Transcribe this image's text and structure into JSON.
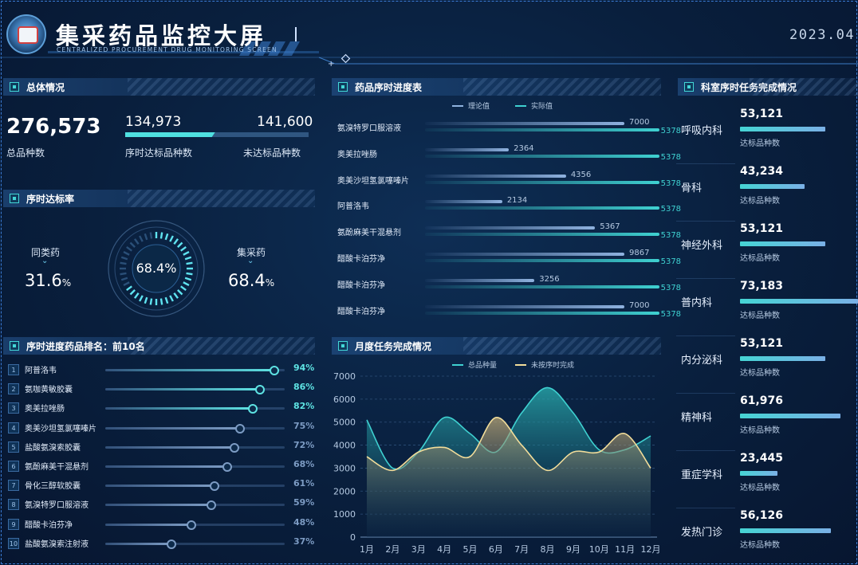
{
  "header": {
    "title": "集采药品监控大屏",
    "subtitle": "CENTRALIZED PROCUREMENT DRUG MONITORING SCREEN",
    "datetime": "2023.04."
  },
  "overview": {
    "title": "总体情况",
    "total_value": "276,573",
    "total_label": "总品种数",
    "on_time_value": "134,973",
    "on_time_label": "序时达标品种数",
    "not_met_value": "141,600",
    "not_met_label": "未达标品种数",
    "on_time_ratio": 0.49
  },
  "rate": {
    "title": "序时达标率",
    "similar_label": "同类药",
    "similar_value": "31.6",
    "center_value": "68.4%",
    "center_fraction": 0.684,
    "collected_label": "集采药",
    "collected_value": "68.4",
    "unit": "%"
  },
  "ranking": {
    "title": "序时进度药品排名：前10名",
    "items": [
      {
        "idx": "1",
        "name": "阿普洛韦",
        "pct": "94%",
        "value": 94
      },
      {
        "idx": "2",
        "name": "氨咖黄敏胶囊",
        "pct": "86%",
        "value": 86
      },
      {
        "idx": "3",
        "name": "奥美拉唑肠",
        "pct": "82%",
        "value": 82
      },
      {
        "idx": "4",
        "name": "奥美沙坦氢氯噻嗪片",
        "pct": "75%",
        "value": 75
      },
      {
        "idx": "5",
        "name": "盐酸氨溴索胶囊",
        "pct": "72%",
        "value": 72
      },
      {
        "idx": "6",
        "name": "氨酚麻美干混悬剂",
        "pct": "68%",
        "value": 68
      },
      {
        "idx": "7",
        "name": "骨化三醇软胶囊",
        "pct": "61%",
        "value": 61
      },
      {
        "idx": "8",
        "name": "氨溴特罗口服溶液",
        "pct": "59%",
        "value": 59
      },
      {
        "idx": "9",
        "name": "醋酸卡泊芬净",
        "pct": "48%",
        "value": 48
      },
      {
        "idx": "10",
        "name": "盐酸氨溴索注射液",
        "pct": "37%",
        "value": 37
      }
    ],
    "colors": {
      "top": "#5ee3e3",
      "rest": "#7d9cc4"
    }
  },
  "schedule": {
    "title": "药品序时进度表",
    "legend_theory": "理论值",
    "legend_actual": "实际值",
    "colors": {
      "theory": "#8fb2df",
      "actual": "#3fd1d1"
    },
    "items": [
      {
        "name": "氨溴特罗口服溶液",
        "theory": 7000,
        "actual": 5378,
        "theory_label": "7000",
        "actual_label": "5378"
      },
      {
        "name": "奥美拉唑肠",
        "theory": 2364,
        "actual": 5378,
        "theory_label": "2364",
        "actual_label": "5378"
      },
      {
        "name": "奥美沙坦氢氯噻嗪片",
        "theory": 4356,
        "actual": 5378,
        "theory_label": "4356",
        "actual_label": "5378"
      },
      {
        "name": "阿普洛韦",
        "theory": 2134,
        "actual": 5378,
        "theory_label": "2134",
        "actual_label": "5378"
      },
      {
        "name": "氨酚麻美干混悬剂",
        "theory": 5367,
        "actual": 5378,
        "theory_label": "5367",
        "actual_label": "5378"
      },
      {
        "name": "醋酸卡泊芬净",
        "theory": 9867,
        "actual": 5378,
        "theory_label": "9867",
        "actual_label": "5378"
      },
      {
        "name": "醋酸卡泊芬净",
        "theory": 3256,
        "actual": 5378,
        "theory_label": "3256",
        "actual_label": "5378"
      },
      {
        "name": "醋酸卡泊芬净",
        "theory": 7000,
        "actual": 5378,
        "theory_label": "7000",
        "actual_label": "5378"
      }
    ]
  },
  "chart_data": {
    "type": "area",
    "title": "月度任务完成情况",
    "categories": [
      "1月",
      "2月",
      "3月",
      "4月",
      "5月",
      "6月",
      "7月",
      "8月",
      "9月",
      "10月",
      "11月",
      "12月"
    ],
    "ylim": [
      0,
      7000
    ],
    "yticks": [
      0,
      1000,
      2000,
      3000,
      4000,
      5000,
      6000,
      7000
    ],
    "grid": true,
    "legend": "top-center",
    "series": [
      {
        "name": "总品种量",
        "color": "#3fd1d1",
        "values": [
          5100,
          3000,
          3700,
          5200,
          4500,
          3700,
          5400,
          6500,
          5400,
          3800,
          3800,
          4400
        ]
      },
      {
        "name": "未按序时完成",
        "color": "#f2dd9a",
        "values": [
          3500,
          2900,
          3700,
          3900,
          3500,
          5200,
          4000,
          2900,
          3700,
          3700,
          4500,
          3000
        ]
      }
    ]
  },
  "departments": {
    "title": "科室序时任务完成情况",
    "item_label": "达标品种数",
    "items": [
      {
        "name": "呼吸内科",
        "value": "53,121",
        "ratio": 0.72
      },
      {
        "name": "骨科",
        "value": "43,234",
        "ratio": 0.55
      },
      {
        "name": "神经外科",
        "value": "53,121",
        "ratio": 0.72
      },
      {
        "name": "普内科",
        "value": "73,183",
        "ratio": 1.0
      },
      {
        "name": "内分泌科",
        "value": "53,121",
        "ratio": 0.72
      },
      {
        "name": "精神科",
        "value": "61,976",
        "ratio": 0.85
      },
      {
        "name": "重症学科",
        "value": "23,445",
        "ratio": 0.32
      },
      {
        "name": "发热门诊",
        "value": "56,126",
        "ratio": 0.77
      }
    ]
  }
}
